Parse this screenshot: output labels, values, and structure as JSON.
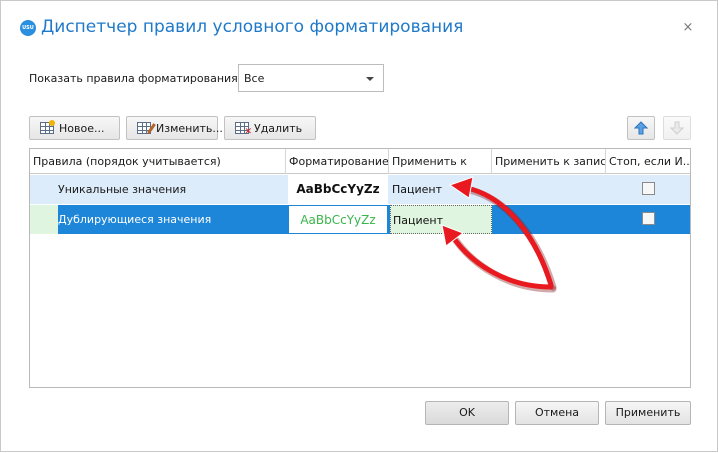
{
  "window": {
    "title": "Диспетчер правил условного форматирования",
    "logo_text": "USU",
    "close_glyph": "×"
  },
  "filter": {
    "label": "Показать правила форматирования для:",
    "selected": "Все"
  },
  "toolbar": {
    "new_label": "Новое...",
    "edit_label": "Изменить...",
    "delete_label": "Удалить"
  },
  "grid": {
    "columns": [
      "Правила (порядок учитывается)",
      "Форматирование",
      "Применить к",
      "Применить к записи",
      "Стоп, если И..."
    ],
    "rows": [
      {
        "rule": "Уникальные значения",
        "preview": "AaBbCcYyZz",
        "apply_to": "Пациент",
        "apply_record": "",
        "stop_if_true": false
      },
      {
        "rule": "Дублирующиеся значения",
        "preview": "AaBbCcYyZz",
        "apply_to": "Пациент",
        "apply_record": "",
        "stop_if_true": false
      }
    ]
  },
  "footer": {
    "ok_label": "OK",
    "cancel_label": "Отмена",
    "apply_label": "Применить"
  },
  "colors": {
    "title": "#1f79c8",
    "selection": "#1e86d8",
    "annotation_arrow": "#e8191f"
  }
}
